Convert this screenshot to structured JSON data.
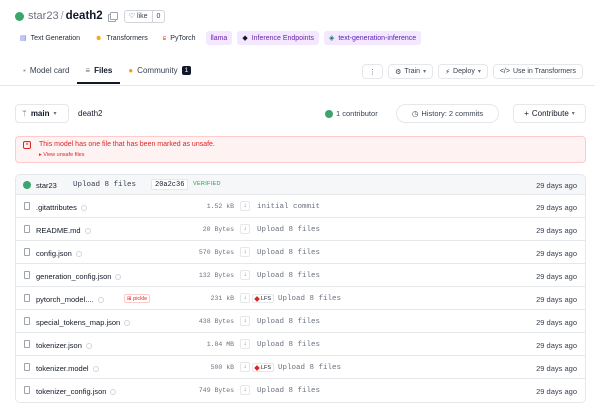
{
  "repo": {
    "owner": "star23",
    "name": "death2",
    "like_label": "like",
    "like_count": "0"
  },
  "tags": [
    {
      "label": "Text Generation",
      "icon": "text-generation-icon",
      "color": "#6366f1"
    },
    {
      "label": "Transformers",
      "icon": "transformers-icon",
      "color": "#f59e0b"
    },
    {
      "label": "PyTorch",
      "icon": "pytorch-icon",
      "color": "#ee4c2c"
    },
    {
      "label": "llama",
      "icon": "",
      "color": "#6b21a8"
    },
    {
      "label": "Inference Endpoints",
      "icon": "inference-endpoints-icon",
      "color": "#6b21a8"
    },
    {
      "label": "text-generation-inference",
      "icon": "tgi-icon",
      "color": "#5b21b6"
    }
  ],
  "tabs": [
    {
      "label": "Model card",
      "icon": "model-card-icon"
    },
    {
      "label": "Files",
      "icon": "files-icon"
    },
    {
      "label": "Community",
      "icon": "community-icon",
      "badge": "1"
    }
  ],
  "actions": {
    "more": "⋮",
    "train": "Train",
    "deploy": "Deploy",
    "use_in": "Use in Transformers"
  },
  "branch": {
    "name": "main",
    "path": "death2",
    "contributors": "1 contributor",
    "history": "History: 2 commits",
    "contribute": "Contribute"
  },
  "warning": {
    "text": "This model has one file that has been marked as unsafe.",
    "link": "View unsafe files"
  },
  "last_commit": {
    "user": "star23",
    "message": "Upload 8 files",
    "hash": "20a2c36",
    "verified": "VERIFIED",
    "ago": "29 days ago"
  },
  "files": [
    {
      "name": ".gitattributes",
      "size": "1.52 kB",
      "lfs": false,
      "pickle": false,
      "commit": "initial commit",
      "ago": "29 days ago"
    },
    {
      "name": "README.md",
      "size": "20 Bytes",
      "lfs": false,
      "pickle": false,
      "commit": "Upload 8 files",
      "ago": "29 days ago"
    },
    {
      "name": "config.json",
      "size": "570 Bytes",
      "lfs": false,
      "pickle": false,
      "commit": "Upload 8 files",
      "ago": "29 days ago"
    },
    {
      "name": "generation_config.json",
      "size": "132 Bytes",
      "lfs": false,
      "pickle": false,
      "commit": "Upload 8 files",
      "ago": "29 days ago"
    },
    {
      "name": "pytorch_model....",
      "size": "231 kB",
      "lfs": true,
      "pickle": true,
      "pickle_label": "pickle",
      "commit": "Upload 8 files",
      "ago": "29 days ago"
    },
    {
      "name": "special_tokens_map.json",
      "size": "438 Bytes",
      "lfs": false,
      "pickle": false,
      "commit": "Upload 8 files",
      "ago": "29 days ago"
    },
    {
      "name": "tokenizer.json",
      "size": "1.84 MB",
      "lfs": false,
      "pickle": false,
      "commit": "Upload 8 files",
      "ago": "29 days ago"
    },
    {
      "name": "tokenizer.model",
      "size": "500 kB",
      "lfs": true,
      "pickle": false,
      "commit": "Upload 8 files",
      "ago": "29 days ago"
    },
    {
      "name": "tokenizer_config.json",
      "size": "749 Bytes",
      "lfs": false,
      "pickle": false,
      "commit": "Upload 8 files",
      "ago": "29 days ago"
    }
  ],
  "lfs_label": "LFS",
  "download_glyph": "↓"
}
